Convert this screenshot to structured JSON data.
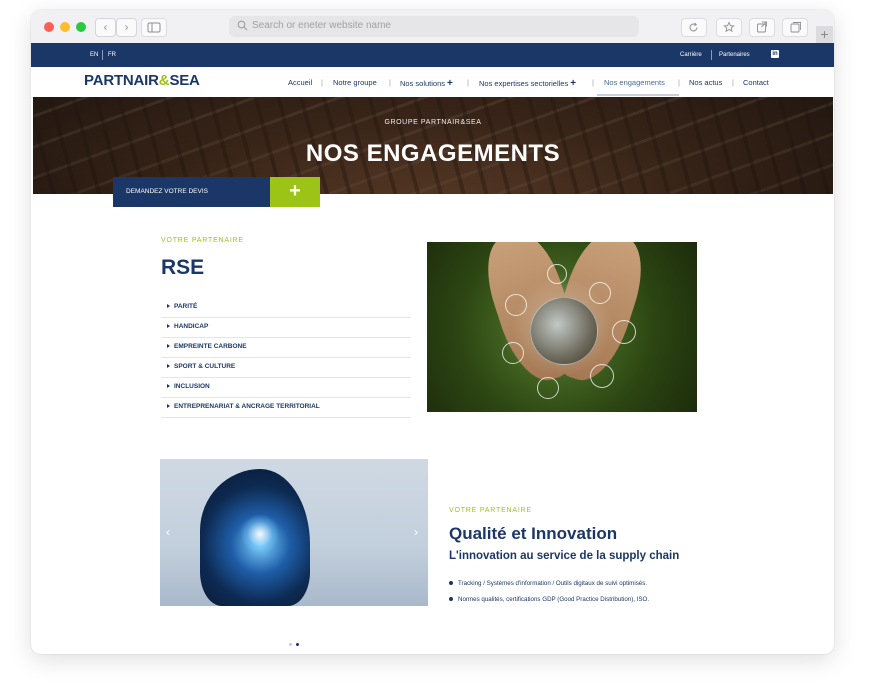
{
  "browser": {
    "url_placeholder": "Search or eneter website name",
    "back_icon": "‹",
    "forward_icon": "›",
    "new_tab_icon": "+"
  },
  "topbar": {
    "lang_en": "EN",
    "lang_fr": "FR",
    "carriere": "Carrière",
    "partenaires": "Partenaires",
    "linkedin": "in"
  },
  "nav": {
    "logo_main": "PARTNAIR",
    "logo_amp": "&",
    "logo_end": "SEA",
    "items": [
      "Accueil",
      "Notre groupe",
      "Nos solutions",
      "Nos expertises sectorielles",
      "Nos engagements",
      "Nos actus",
      "Contact"
    ],
    "plus": "+",
    "separator": "|"
  },
  "hero": {
    "subtitle": "GROUPE PARTNAIR&SEA",
    "title": "NOS ENGAGEMENTS"
  },
  "devis": {
    "label": "DEMANDEZ VOTRE DEVIS",
    "plus": "+"
  },
  "rse": {
    "kicker": "VOTRE PARTENAIRE",
    "title": "RSE",
    "items": [
      "PARITÉ",
      "HANDICAP",
      "EMPREINTE CARBONE",
      "SPORT & CULTURE",
      "INCLUSION",
      "ENTREPRENARIAT & ANCRAGE TERRITORIAL"
    ]
  },
  "qualite": {
    "kicker": "VOTRE PARTENAIRE",
    "title": "Qualité et Innovation",
    "subtitle": "L'innovation au service de la supply chain",
    "bullets": [
      "Tracking / Systèmes d'information / Outils digitaux de suivi optimisés.",
      "Normes qualités, certifications GDP (Good Practice Distribution), ISO."
    ],
    "prev": "‹",
    "next": "›"
  },
  "carousel": {
    "slide_count": 2,
    "active_index": 1
  },
  "colors": {
    "navy": "#1b3767",
    "lime": "#9cc417"
  }
}
